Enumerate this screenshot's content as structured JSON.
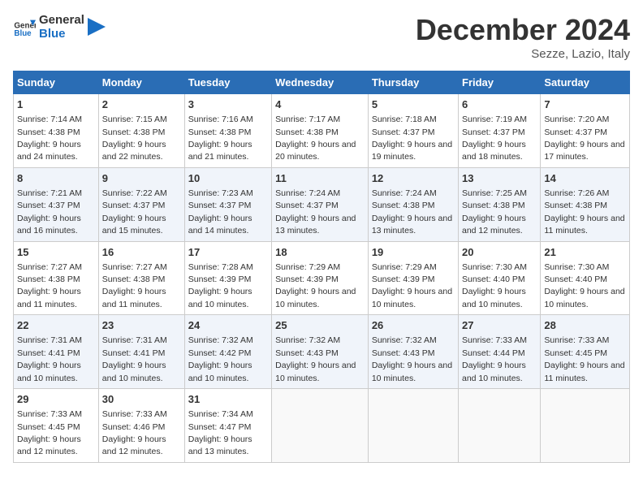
{
  "logo": {
    "line1": "General",
    "line2": "Blue"
  },
  "title": "December 2024",
  "subtitle": "Sezze, Lazio, Italy",
  "days_of_week": [
    "Sunday",
    "Monday",
    "Tuesday",
    "Wednesday",
    "Thursday",
    "Friday",
    "Saturday"
  ],
  "weeks": [
    [
      {
        "day": "1",
        "sunrise": "7:14 AM",
        "sunset": "4:38 PM",
        "daylight": "9 hours and 24 minutes."
      },
      {
        "day": "2",
        "sunrise": "7:15 AM",
        "sunset": "4:38 PM",
        "daylight": "9 hours and 22 minutes."
      },
      {
        "day": "3",
        "sunrise": "7:16 AM",
        "sunset": "4:38 PM",
        "daylight": "9 hours and 21 minutes."
      },
      {
        "day": "4",
        "sunrise": "7:17 AM",
        "sunset": "4:38 PM",
        "daylight": "9 hours and 20 minutes."
      },
      {
        "day": "5",
        "sunrise": "7:18 AM",
        "sunset": "4:37 PM",
        "daylight": "9 hours and 19 minutes."
      },
      {
        "day": "6",
        "sunrise": "7:19 AM",
        "sunset": "4:37 PM",
        "daylight": "9 hours and 18 minutes."
      },
      {
        "day": "7",
        "sunrise": "7:20 AM",
        "sunset": "4:37 PM",
        "daylight": "9 hours and 17 minutes."
      }
    ],
    [
      {
        "day": "8",
        "sunrise": "7:21 AM",
        "sunset": "4:37 PM",
        "daylight": "9 hours and 16 minutes."
      },
      {
        "day": "9",
        "sunrise": "7:22 AM",
        "sunset": "4:37 PM",
        "daylight": "9 hours and 15 minutes."
      },
      {
        "day": "10",
        "sunrise": "7:23 AM",
        "sunset": "4:37 PM",
        "daylight": "9 hours and 14 minutes."
      },
      {
        "day": "11",
        "sunrise": "7:24 AM",
        "sunset": "4:37 PM",
        "daylight": "9 hours and 13 minutes."
      },
      {
        "day": "12",
        "sunrise": "7:24 AM",
        "sunset": "4:38 PM",
        "daylight": "9 hours and 13 minutes."
      },
      {
        "day": "13",
        "sunrise": "7:25 AM",
        "sunset": "4:38 PM",
        "daylight": "9 hours and 12 minutes."
      },
      {
        "day": "14",
        "sunrise": "7:26 AM",
        "sunset": "4:38 PM",
        "daylight": "9 hours and 11 minutes."
      }
    ],
    [
      {
        "day": "15",
        "sunrise": "7:27 AM",
        "sunset": "4:38 PM",
        "daylight": "9 hours and 11 minutes."
      },
      {
        "day": "16",
        "sunrise": "7:27 AM",
        "sunset": "4:38 PM",
        "daylight": "9 hours and 11 minutes."
      },
      {
        "day": "17",
        "sunrise": "7:28 AM",
        "sunset": "4:39 PM",
        "daylight": "9 hours and 10 minutes."
      },
      {
        "day": "18",
        "sunrise": "7:29 AM",
        "sunset": "4:39 PM",
        "daylight": "9 hours and 10 minutes."
      },
      {
        "day": "19",
        "sunrise": "7:29 AM",
        "sunset": "4:39 PM",
        "daylight": "9 hours and 10 minutes."
      },
      {
        "day": "20",
        "sunrise": "7:30 AM",
        "sunset": "4:40 PM",
        "daylight": "9 hours and 10 minutes."
      },
      {
        "day": "21",
        "sunrise": "7:30 AM",
        "sunset": "4:40 PM",
        "daylight": "9 hours and 10 minutes."
      }
    ],
    [
      {
        "day": "22",
        "sunrise": "7:31 AM",
        "sunset": "4:41 PM",
        "daylight": "9 hours and 10 minutes."
      },
      {
        "day": "23",
        "sunrise": "7:31 AM",
        "sunset": "4:41 PM",
        "daylight": "9 hours and 10 minutes."
      },
      {
        "day": "24",
        "sunrise": "7:32 AM",
        "sunset": "4:42 PM",
        "daylight": "9 hours and 10 minutes."
      },
      {
        "day": "25",
        "sunrise": "7:32 AM",
        "sunset": "4:43 PM",
        "daylight": "9 hours and 10 minutes."
      },
      {
        "day": "26",
        "sunrise": "7:32 AM",
        "sunset": "4:43 PM",
        "daylight": "9 hours and 10 minutes."
      },
      {
        "day": "27",
        "sunrise": "7:33 AM",
        "sunset": "4:44 PM",
        "daylight": "9 hours and 10 minutes."
      },
      {
        "day": "28",
        "sunrise": "7:33 AM",
        "sunset": "4:45 PM",
        "daylight": "9 hours and 11 minutes."
      }
    ],
    [
      {
        "day": "29",
        "sunrise": "7:33 AM",
        "sunset": "4:45 PM",
        "daylight": "9 hours and 12 minutes."
      },
      {
        "day": "30",
        "sunrise": "7:33 AM",
        "sunset": "4:46 PM",
        "daylight": "9 hours and 12 minutes."
      },
      {
        "day": "31",
        "sunrise": "7:34 AM",
        "sunset": "4:47 PM",
        "daylight": "9 hours and 13 minutes."
      },
      null,
      null,
      null,
      null
    ]
  ]
}
